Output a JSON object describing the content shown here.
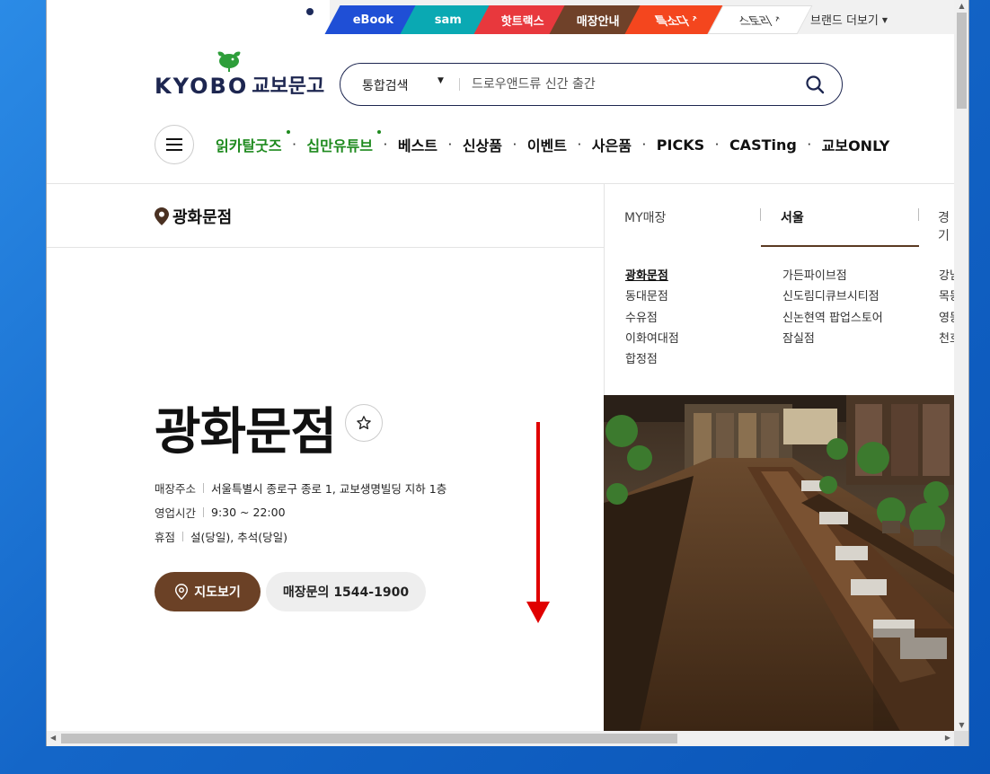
{
  "brand_tabs": [
    {
      "label": "eBook"
    },
    {
      "label": "sam"
    },
    {
      "label": "핫트랙스"
    },
    {
      "label": "매장안내"
    },
    {
      "label": "특소다"
    },
    {
      "label": "스토리"
    }
  ],
  "brand_more": "브랜드 더보기",
  "logo": {
    "en": "KYOBO",
    "ko": "교보문고"
  },
  "search": {
    "category": "통합검색",
    "placeholder": "드로우앤드류 신간 출간"
  },
  "gnb": [
    {
      "label": "읽카탈굿즈"
    },
    {
      "label": "십만유튜브"
    },
    {
      "label": "베스트"
    },
    {
      "label": "신상품"
    },
    {
      "label": "이벤트"
    },
    {
      "label": "사은품"
    },
    {
      "label": "PICKS"
    },
    {
      "label": "CASTing"
    },
    {
      "label": "교보ONLY"
    }
  ],
  "location": {
    "current": "광화문점"
  },
  "region_tabs": {
    "my": "MY매장",
    "seoul": "서울",
    "gyeonggi": "경기"
  },
  "stores": {
    "col1": [
      "광화문점",
      "동대문점",
      "수유점",
      "이화여대점",
      "합정점"
    ],
    "col2": [
      "가든파이브점",
      "신도림디큐브시티점",
      "신논현역 팝업스토어",
      "잠실점"
    ],
    "col3": [
      "강남점",
      "목동점",
      "영등포점",
      "천호점"
    ]
  },
  "store": {
    "title": "광화문점",
    "address_label": "매장주소",
    "address": "서울특별시 종로구 종로 1, 교보생명빌딩 지하 1층",
    "hours_label": "영업시간",
    "hours": "9:30 ~ 22:00",
    "closed_label": "휴점",
    "closed": "설(당일), 추석(당일)",
    "map_button": "지도보기",
    "call_button": "매장문의 1544-1900"
  },
  "colors": {
    "brand_navy": "#1d2650",
    "brown": "#6b4126",
    "green": "#1e8a1e",
    "arrow_red": "#e00000"
  }
}
